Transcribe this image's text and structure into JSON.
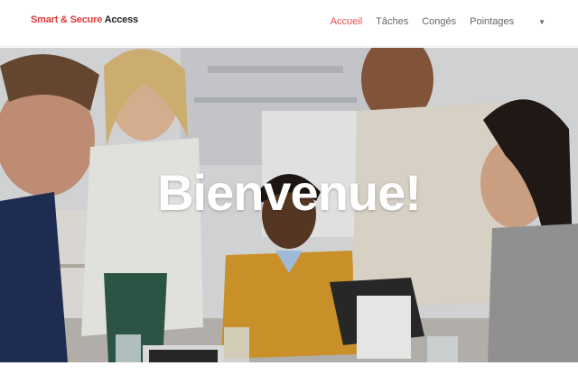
{
  "brand": {
    "part1": "Smart & Secure",
    "part2": "Access"
  },
  "nav": {
    "items": [
      "Accueil",
      "Tâches",
      "Congés",
      "Pointages"
    ],
    "active": "Accueil",
    "more_icon": "caret-down-icon"
  },
  "hero": {
    "title": "Bienvenue!"
  },
  "colors": {
    "accent": "#e8484a",
    "brand_red": "#e03a3a",
    "nav_text": "#666666"
  }
}
